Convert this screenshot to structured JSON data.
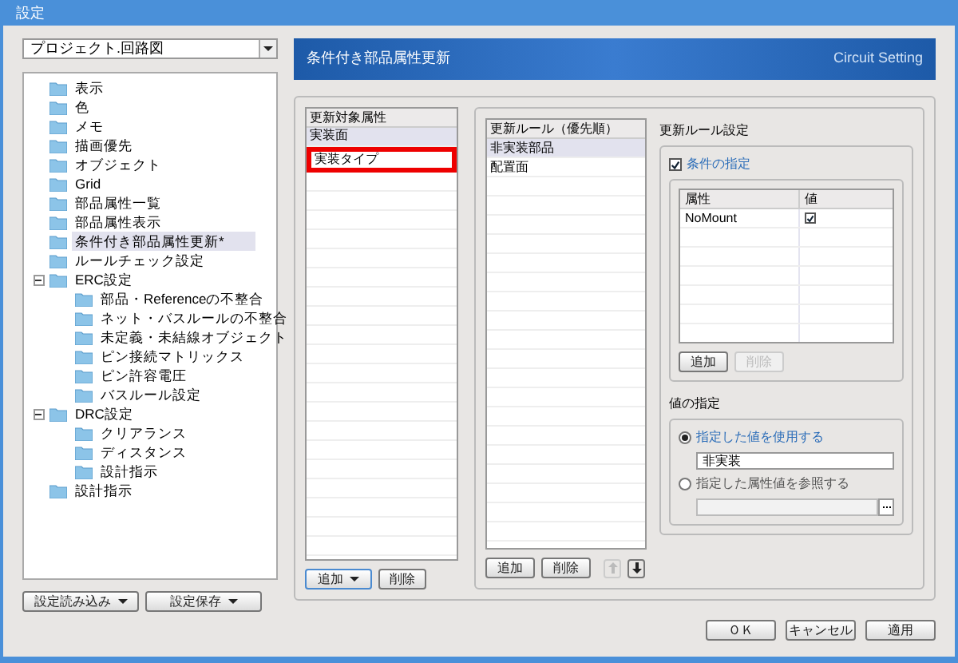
{
  "window": {
    "title": "設定"
  },
  "scope_dropdown": {
    "value": "プロジェクト.回路図"
  },
  "tree": [
    {
      "label": "表示",
      "selected": false
    },
    {
      "label": "色",
      "selected": false
    },
    {
      "label": "メモ",
      "selected": false
    },
    {
      "label": "描画優先",
      "selected": false
    },
    {
      "label": "オブジェクト",
      "selected": false
    },
    {
      "label": "Grid",
      "selected": false
    },
    {
      "label": "部品属性一覧",
      "selected": false
    },
    {
      "label": "部品属性表示",
      "selected": false
    },
    {
      "label": "条件付き部品属性更新*",
      "selected": true
    },
    {
      "label": "ルールチェック設定",
      "selected": false
    },
    {
      "label": "ERC設定",
      "selected": false,
      "expanded": true,
      "children": [
        {
          "label": "部品・Referenceの不整合",
          "selected": false
        },
        {
          "label": "ネット・バスルールの不整合",
          "selected": false
        },
        {
          "label": "未定義・未結線オブジェクト",
          "selected": false
        },
        {
          "label": "ピン接続マトリックス",
          "selected": false
        },
        {
          "label": "ピン許容電圧",
          "selected": false
        },
        {
          "label": "バスルール設定",
          "selected": false
        }
      ]
    },
    {
      "label": "DRC設定",
      "selected": false,
      "expanded": true,
      "children": [
        {
          "label": "クリアランス",
          "selected": false
        },
        {
          "label": "ディスタンス",
          "selected": false
        },
        {
          "label": "設計指示",
          "selected": false
        }
      ]
    },
    {
      "label": "設計指示",
      "selected": false
    }
  ],
  "left_buttons": [
    "設定読み込み",
    "設定保存"
  ],
  "header": {
    "title": "条件付き部品属性更新",
    "brand": "Circuit Setting"
  },
  "target_list": {
    "heading": "更新対象属性",
    "items": [
      {
        "label": "実装面",
        "selected": true,
        "highlighted": false
      },
      {
        "label": "実装タイプ",
        "selected": false,
        "highlighted": true
      }
    ],
    "buttons": [
      {
        "label": "追加",
        "disabled": false
      },
      {
        "label": "削除",
        "disabled": false
      }
    ]
  },
  "rule_list": {
    "heading": "更新ルール（優先順）",
    "items": [
      {
        "label": "非実装部品",
        "selected": true
      },
      {
        "label": "配置面",
        "selected": false
      }
    ],
    "buttons": [
      {
        "label": "追加",
        "disabled": false
      },
      {
        "label": "削除",
        "disabled": false
      }
    ],
    "up_disabled": true,
    "down_disabled": false
  },
  "rule_settings": {
    "title": "更新ルール設定",
    "condition": {
      "label": "条件の指定",
      "checked": true
    },
    "table": {
      "columns": [
        "属性",
        "値"
      ],
      "rows": [
        {
          "attribute": "NoMount",
          "checked": true
        }
      ]
    },
    "buttons": [
      {
        "label": "追加",
        "disabled": false
      },
      {
        "label": "削除",
        "disabled": true
      }
    ],
    "value_group": {
      "title": "値の指定",
      "options": [
        {
          "label": "指定した値を使用する",
          "selected": true,
          "value": "非実装",
          "kind": "text"
        },
        {
          "label": "指定した属性値を参照する",
          "selected": false,
          "kind": "browse"
        }
      ]
    }
  },
  "dialog_buttons": [
    "ＯＫ",
    "キャンセル",
    "適用"
  ]
}
